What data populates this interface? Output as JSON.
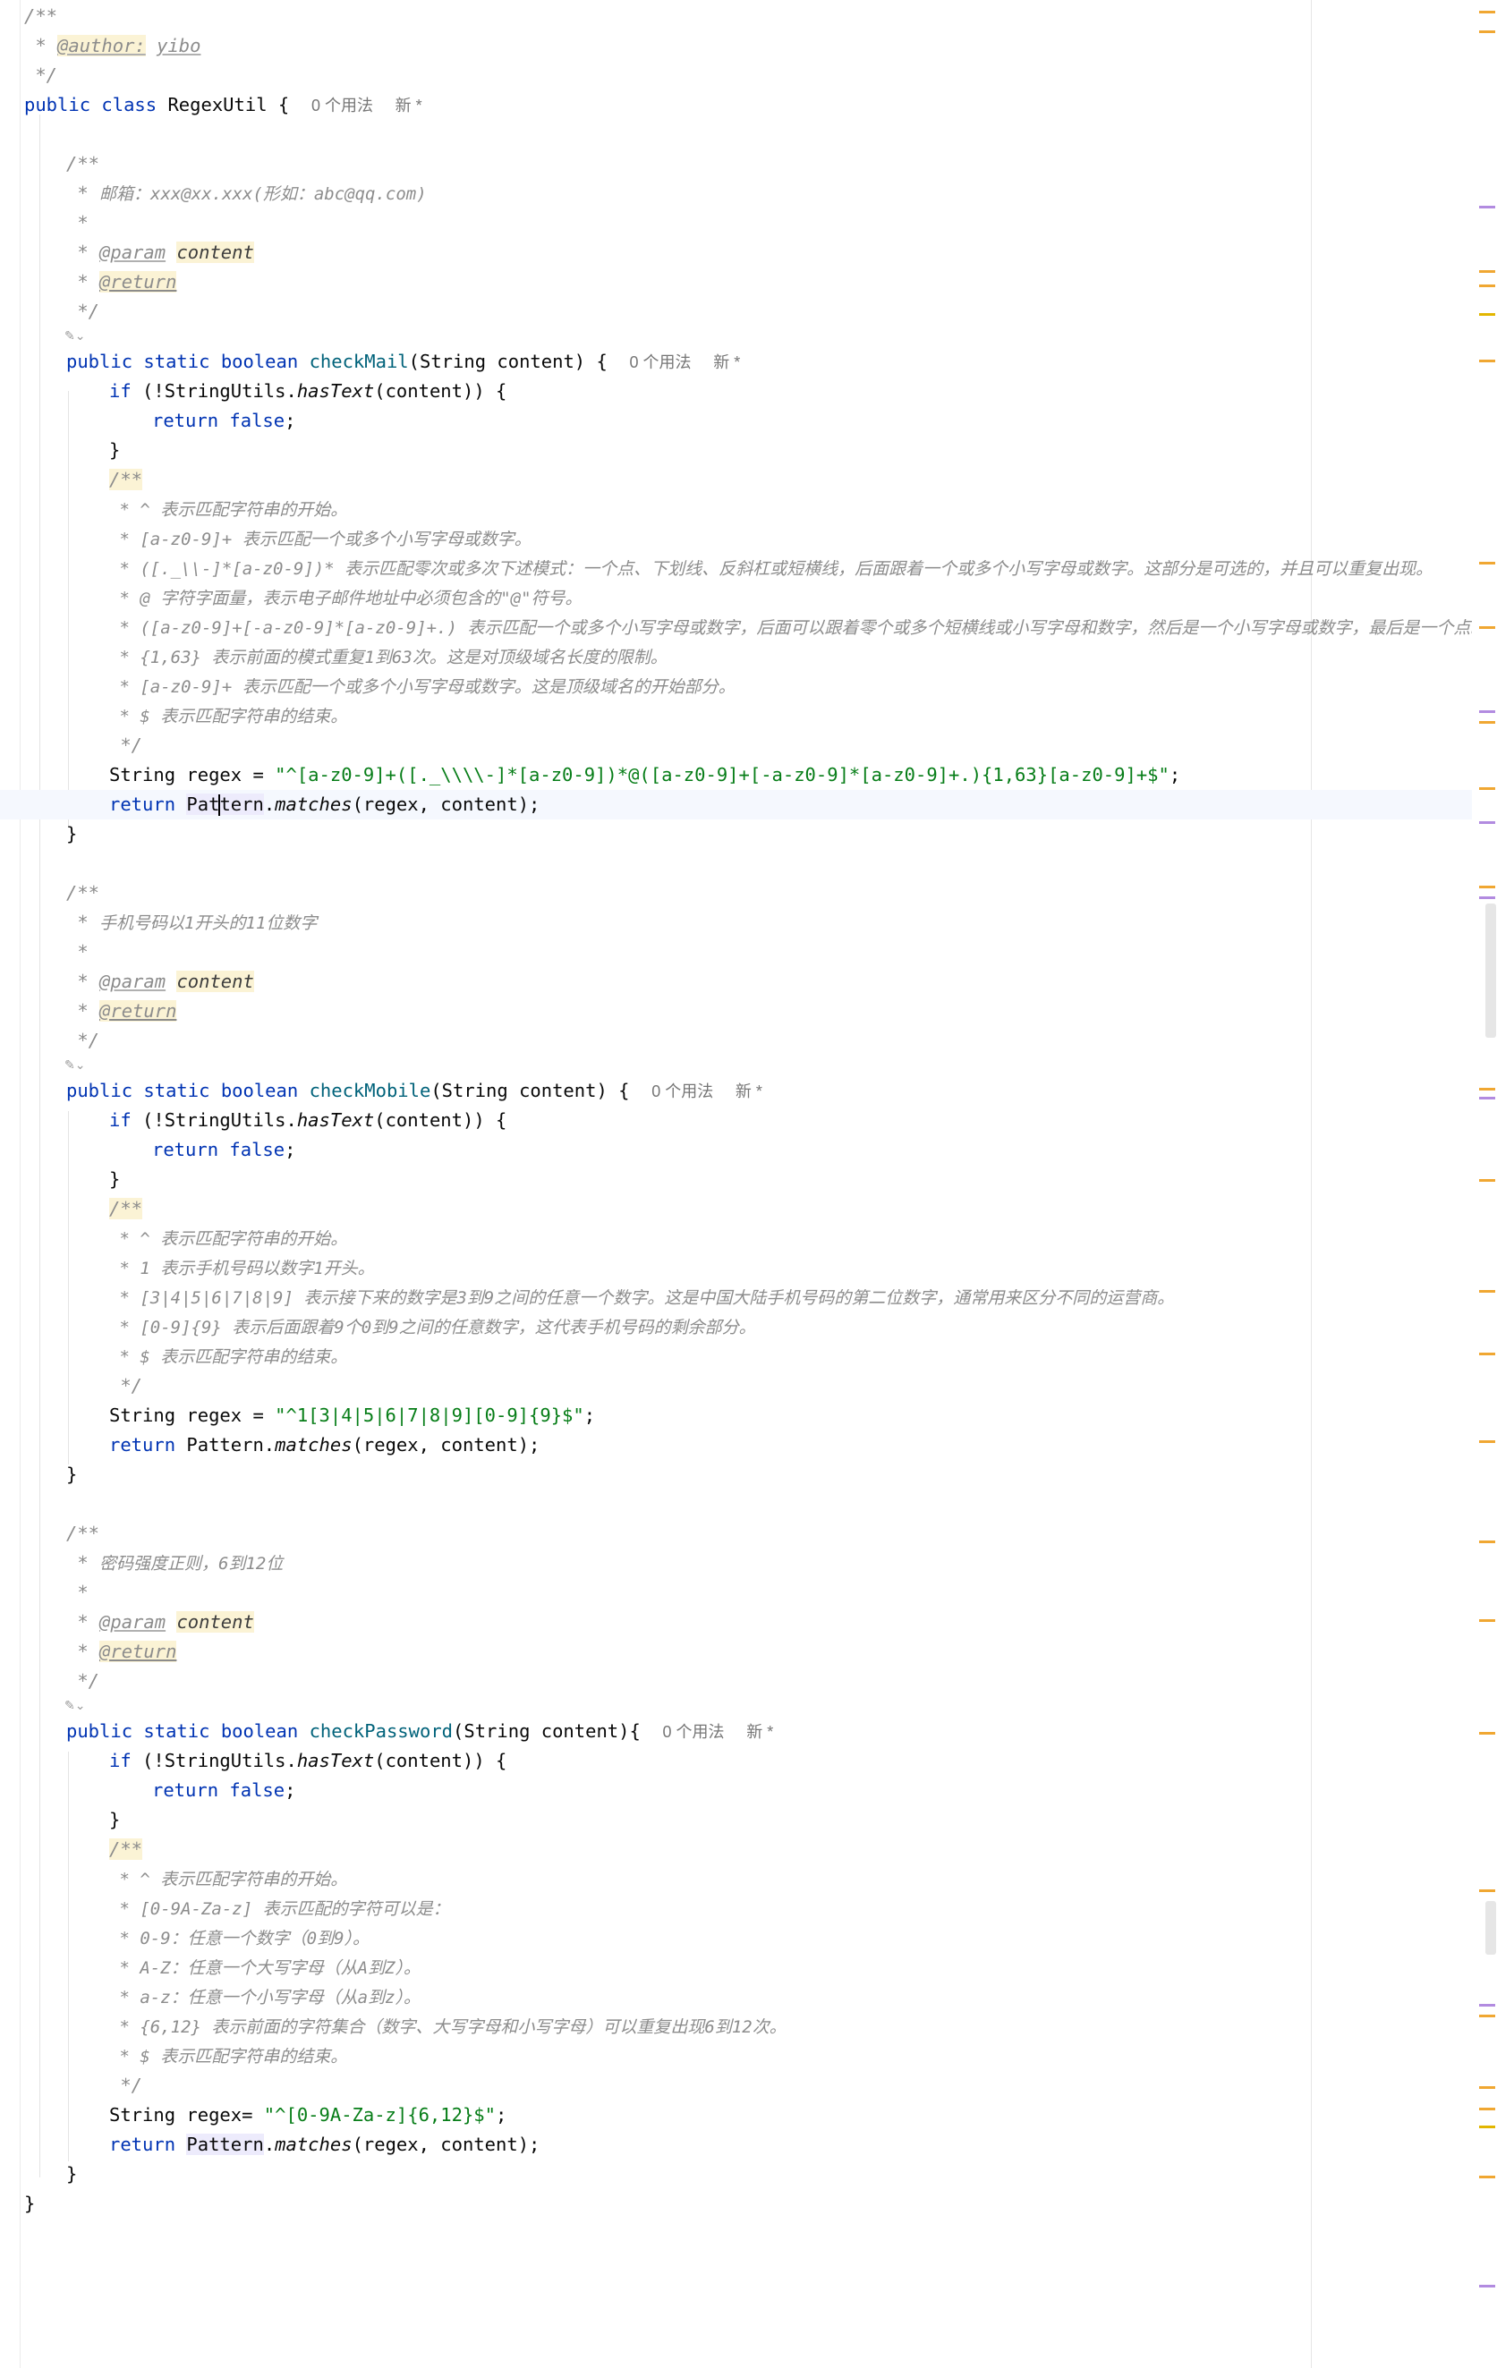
{
  "file": {
    "author_tag": "@author:",
    "author_name": "yibo",
    "class_name": "RegexUtil"
  },
  "hints": {
    "usage": "0 个用法",
    "new": "新 *"
  },
  "keywords": {
    "public": "public",
    "class": "class",
    "static": "static",
    "boolean": "boolean",
    "if": "if",
    "return": "return",
    "false": "false",
    "String": "String"
  },
  "doc": {
    "open": "/**",
    "close": "*/",
    "star": "*",
    "param_tag": "@param",
    "param_name": "content",
    "return_tag": "@return"
  },
  "mail": {
    "doc_desc": "邮箱：xxx@xx.xxx(形如：abc@qq.com)",
    "signature_name": "checkMail",
    "signature_args": "(String content) {",
    "comment_lines": [
      "* ^ 表示匹配字符串的开始。",
      "* [a-z0-9]+ 表示匹配一个或多个小写字母或数字。",
      "* ([._\\\\-]*[a-z0-9])* 表示匹配零次或多次下述模式：一个点、下划线、反斜杠或短横线，后面跟着一个或多个小写字母或数字。这部分是可选的，并且可以重复出现。",
      "* @ 字符字面量，表示电子邮件地址中必须包含的\"@\"符号。",
      "* ([a-z0-9]+[-a-z0-9]*[a-z0-9]+.) 表示匹配一个或多个小写字母或数字，后面可以跟着零个或多个短横线或小写字母和数字，然后是一个小写字母或数字，最后是一个点。",
      "* {1,63} 表示前面的模式重复1到63次。这是对顶级域名长度的限制。",
      "* [a-z0-9]+ 表示匹配一个或多个小写字母或数字。这是顶级域名的开始部分。",
      "* $ 表示匹配字符串的结束。"
    ],
    "regex_line_prefix": "String regex = ",
    "regex_value": "\"^[a-z0-9]+([._\\\\\\\\-]*[a-z0-9])*@([a-z0-9]+[-a-z0-9]*[a-z0-9]+.){1,63}[a-z0-9]+$\"",
    "return_line": "return Pattern.matches(regex, content);"
  },
  "mobile": {
    "doc_desc": "手机号码以1开头的11位数字",
    "signature_name": "checkMobile",
    "signature_args": "(String content) {",
    "comment_lines": [
      "* ^ 表示匹配字符串的开始。",
      "* 1 表示手机号码以数字1开头。",
      "* [3|4|5|6|7|8|9] 表示接下来的数字是3到9之间的任意一个数字。这是中国大陆手机号码的第二位数字，通常用来区分不同的运营商。",
      "* [0-9]{9} 表示后面跟着9个0到9之间的任意数字，这代表手机号码的剩余部分。",
      "* $ 表示匹配字符串的结束。"
    ],
    "regex_value": "\"^1[3|4|5|6|7|8|9][0-9]{9}$\"",
    "return_line": "return Pattern.matches(regex, content);"
  },
  "password": {
    "doc_desc": "密码强度正则，6到12位",
    "signature_name": "checkPassword",
    "signature_args": "(String content){",
    "comment_lines": [
      "* ^ 表示匹配字符串的开始。",
      "* [0-9A-Za-z] 表示匹配的字符可以是：",
      "* 0-9：任意一个数字（0到9）。",
      "* A-Z：任意一个大写字母（从A到Z）。",
      "* a-z：任意一个小写字母（从a到z）。",
      "* {6,12} 表示前面的字符集合（数字、大写字母和小写字母）可以重复出现6到12次。",
      "* $ 表示匹配字符串的结束。"
    ],
    "regex_line_prefix": "String regex= ",
    "regex_value": "\"^[0-9A-Za-z]{6,12}$\"",
    "return_line": "return Pattern.matches(regex, content);"
  },
  "code": {
    "if_line": "if (!StringUtils.hasText(content)) {",
    "return_false": "return false;",
    "close_brace": "}"
  },
  "colors": {
    "keyword": "#0033b3",
    "comment": "#8c8c8c",
    "string": "#067d17",
    "number": "#1750eb",
    "method": "#00627a",
    "highlight": "#fbf3d5",
    "marker_orange": "#f0a732",
    "marker_yellow": "#e2b600",
    "marker_purple": "#b28be0"
  },
  "icons": {
    "gutter": "ai-assistant-icon",
    "scroll_markers": "error-stripe-markers"
  }
}
